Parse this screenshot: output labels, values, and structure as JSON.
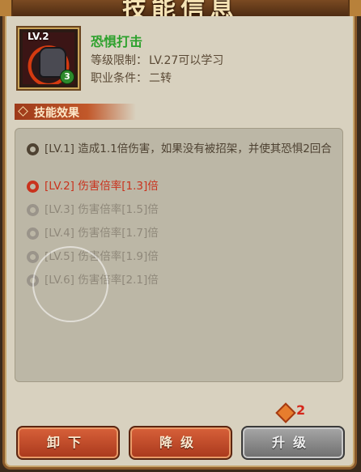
{
  "window": {
    "title": "技能信息"
  },
  "skill": {
    "icon_level": "LV.2",
    "icon_badge": "3",
    "name": "恐惧打击",
    "level_req_label": "等级限制：",
    "level_req_value": "LV.27可以学习",
    "class_req_label": "职业条件：",
    "class_req_value": "二转"
  },
  "section": {
    "label": "技能效果"
  },
  "effects": [
    {
      "text": "[LV.1] 造成1.1倍伤害，如果没有被招架，并使其恐惧2回合",
      "state": "normal"
    },
    {
      "text": "[LV.2] 伤害倍率[1.3]倍",
      "state": "current"
    },
    {
      "text": "[LV.3] 伤害倍率[1.5]倍",
      "state": "dim"
    },
    {
      "text": "[LV.4] 伤害倍率[1.7]倍",
      "state": "dim"
    },
    {
      "text": "[LV.5] 伤害倍率[1.9]倍",
      "state": "dim"
    },
    {
      "text": "[LV.6] 伤害倍率[2.1]倍",
      "state": "dim"
    }
  ],
  "cost": {
    "value": "2",
    "icon": "skill-point-icon"
  },
  "buttons": {
    "unequip": "卸下",
    "downgrade": "降级",
    "upgrade": "升级"
  },
  "colors": {
    "skill_name": "#2ca12c",
    "current_level": "#c9321d",
    "locked_level": "#8f887a",
    "cost": "#d5261a"
  }
}
